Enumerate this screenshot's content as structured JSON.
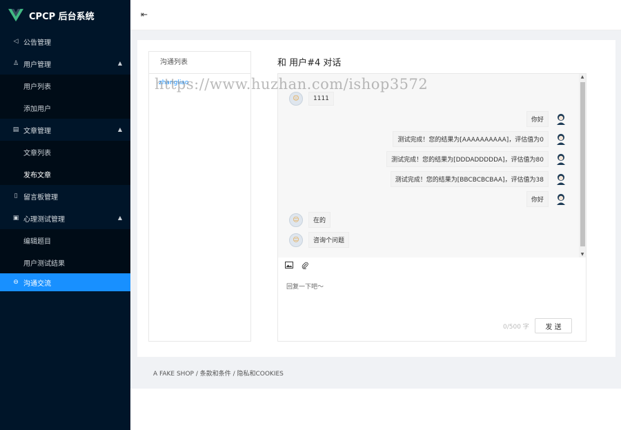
{
  "app": {
    "title": "CPCP 后台系统"
  },
  "sidebar": {
    "items": [
      {
        "label": "公告管理",
        "icon": "notice-icon"
      },
      {
        "label": "用户管理",
        "icon": "user-icon",
        "expanded": true
      },
      {
        "label": "用户列表"
      },
      {
        "label": "添加用户"
      },
      {
        "label": "文章管理",
        "icon": "article-icon",
        "expanded": true
      },
      {
        "label": "文章列表"
      },
      {
        "label": "发布文章"
      },
      {
        "label": "留言板管理",
        "icon": "board-icon"
      },
      {
        "label": "心理测试管理",
        "icon": "test-icon",
        "expanded": true
      },
      {
        "label": "编辑题目"
      },
      {
        "label": "用户测试结果"
      },
      {
        "label": "沟通交流",
        "icon": "chat-icon",
        "active": true
      }
    ]
  },
  "conversations": {
    "header": "沟通列表",
    "items": [
      {
        "name": "zhangliao"
      }
    ]
  },
  "chat": {
    "title": "和 用户#4 对话",
    "messages": [
      {
        "side": "left",
        "text": "1111"
      },
      {
        "side": "right",
        "text": "你好"
      },
      {
        "side": "right",
        "text": "测试完成！您的结果为[AAAAAAAAAA]，评估值为0"
      },
      {
        "side": "right",
        "text": "测试完成！您的结果为[DDDADDDDDA]，评估值为80"
      },
      {
        "side": "right",
        "text": "测试完成！您的结果为[BBCBCBCBAA]，评估值为38"
      },
      {
        "side": "right",
        "text": "你好"
      },
      {
        "side": "left",
        "text": "在的"
      },
      {
        "side": "left",
        "text": "咨询个问题"
      }
    ],
    "input_placeholder": "回复一下吧～",
    "counter": "0/500 字",
    "send_label": "发 送"
  },
  "footer": {
    "text": "A FAKE SHOP / 条款和条件 / 隐私和COOKIES"
  },
  "watermark": "https://www.huzhan.com/ishop3572",
  "colors": {
    "sidebar_bg": "#001529",
    "submenu_bg": "#000c17",
    "accent": "#1890ff",
    "content_bg": "#f0f2f5"
  }
}
